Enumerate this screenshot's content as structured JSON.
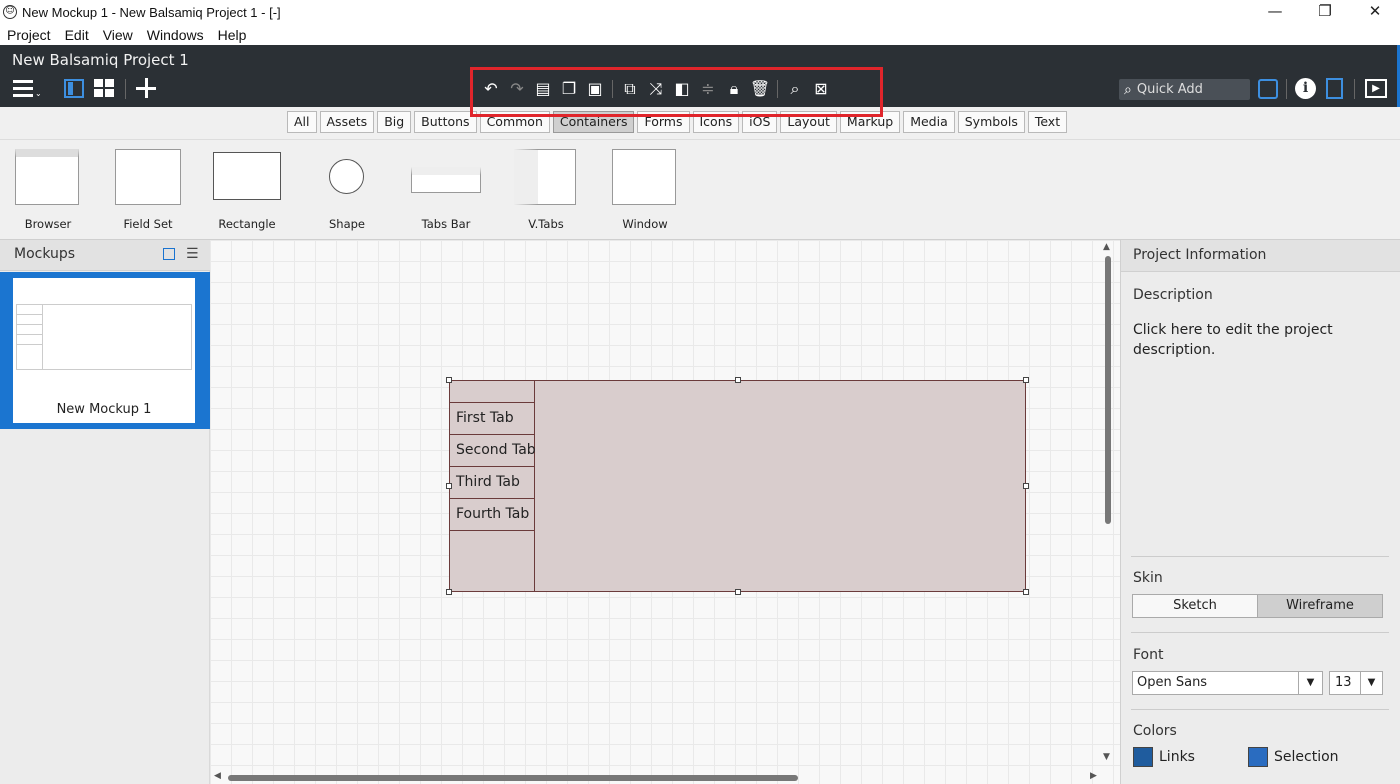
{
  "window": {
    "title": "New Mockup 1 - New Balsamiq Project 1 - [-]",
    "minimize": "—",
    "restore": "❐",
    "close": "✕"
  },
  "menu": [
    "Project",
    "Edit",
    "View",
    "Windows",
    "Help"
  ],
  "header": {
    "project_title": "New Balsamiq Project 1",
    "quick_add_label": "Quick Add"
  },
  "filters": [
    "All",
    "Assets",
    "Big",
    "Buttons",
    "Common",
    "Containers",
    "Forms",
    "Icons",
    "iOS",
    "Layout",
    "Markup",
    "Media",
    "Symbols",
    "Text"
  ],
  "active_filter": "Containers",
  "components": [
    "Browser",
    "Field Set",
    "Rectangle",
    "Shape",
    "Tabs Bar",
    "V.Tabs",
    "Window"
  ],
  "mockups_panel": {
    "title": "Mockups",
    "items": [
      {
        "label": "New Mockup 1"
      }
    ]
  },
  "canvas": {
    "vtabs": [
      "First Tab",
      "Second Tab",
      "Third Tab",
      "Fourth Tab"
    ]
  },
  "right_panel": {
    "title": "Project Information",
    "description_label": "Description",
    "description_text": "Click here to edit the project description.",
    "skin_label": "Skin",
    "skin_options": [
      "Sketch",
      "Wireframe"
    ],
    "skin_selected": "Wireframe",
    "font_label": "Font",
    "font_value": "Open Sans",
    "font_size": "13",
    "colors_label": "Colors",
    "links_label": "Links",
    "selection_label": "Selection",
    "links_color": "#1f5c9e",
    "selection_color": "#2a6cc0"
  },
  "colors": {
    "header_bg": "#2b3035",
    "accent": "#1b75d0",
    "highlight": "#e0252b",
    "widget_fill": "#d9cdcd",
    "widget_border": "#6b3b3b"
  }
}
